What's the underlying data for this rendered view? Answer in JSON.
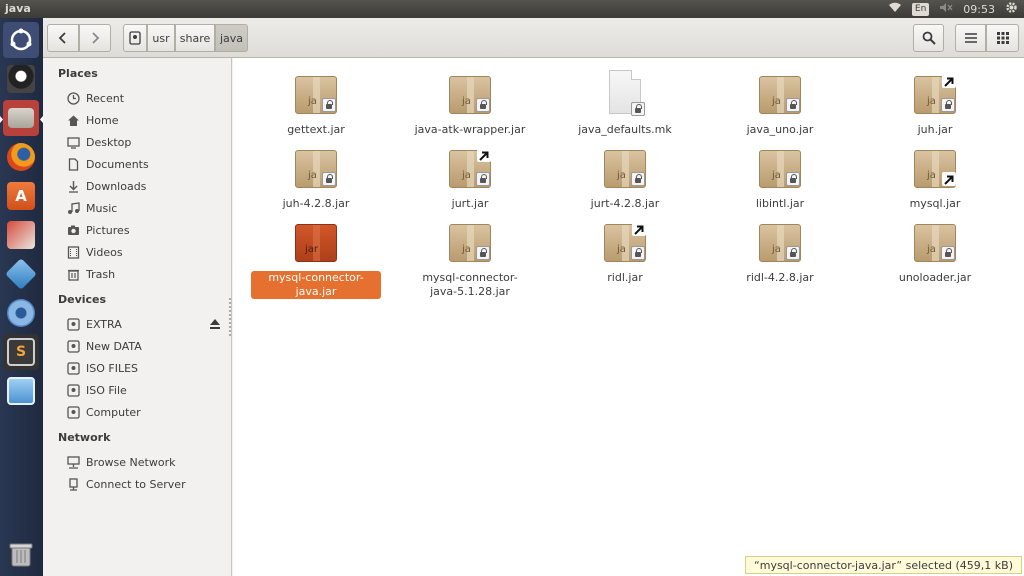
{
  "window_title": "java",
  "topbar": {
    "lang": "En",
    "clock": "09:53"
  },
  "launcher": {
    "apps": [
      "dash-icon",
      "inkscape-icon",
      "files-icon",
      "firefox-icon",
      "software-center-icon",
      "system-settings-icon",
      "virtualbox-icon",
      "tweak-icon",
      "sublime-text-icon",
      "image-viewer-icon",
      "trash-icon"
    ]
  },
  "toolbar": {
    "breadcrumbs": [
      "usr",
      "share",
      "java"
    ]
  },
  "sidebar": {
    "places_title": "Places",
    "places": [
      {
        "label": "Recent",
        "icon": "clock-icon"
      },
      {
        "label": "Home",
        "icon": "home-icon"
      },
      {
        "label": "Desktop",
        "icon": "desktop-icon"
      },
      {
        "label": "Documents",
        "icon": "document-icon"
      },
      {
        "label": "Downloads",
        "icon": "download-icon"
      },
      {
        "label": "Music",
        "icon": "music-icon"
      },
      {
        "label": "Pictures",
        "icon": "camera-icon"
      },
      {
        "label": "Videos",
        "icon": "film-icon"
      },
      {
        "label": "Trash",
        "icon": "trash-icon"
      }
    ],
    "devices_title": "Devices",
    "devices": [
      {
        "label": "EXTRA"
      },
      {
        "label": "New DATA"
      },
      {
        "label": "ISO FILES"
      },
      {
        "label": "ISO File"
      },
      {
        "label": "Computer"
      }
    ],
    "network_title": "Network",
    "network": [
      {
        "label": "Browse Network",
        "icon": "network-icon"
      },
      {
        "label": "Connect to Server",
        "icon": "server-icon"
      }
    ]
  },
  "files": [
    {
      "name": "gettext.jar",
      "type": "jar",
      "link": false
    },
    {
      "name": "java-atk-wrapper.jar",
      "type": "jar",
      "link": false
    },
    {
      "name": "java_defaults.mk",
      "type": "doc",
      "link": false
    },
    {
      "name": "java_uno.jar",
      "type": "jar",
      "link": false
    },
    {
      "name": "juh.jar",
      "type": "jar",
      "link": true
    },
    {
      "name": "juh-4.2.8.jar",
      "type": "jar",
      "link": false
    },
    {
      "name": "jurt.jar",
      "type": "jar",
      "link": true
    },
    {
      "name": "jurt-4.2.8.jar",
      "type": "jar",
      "link": false
    },
    {
      "name": "libintl.jar",
      "type": "jar",
      "link": false
    },
    {
      "name": "mysql.jar",
      "type": "jar",
      "link": true,
      "link_bottom": true
    },
    {
      "name": "mysql-connector-java.jar",
      "type": "jar",
      "link": false,
      "selected": true
    },
    {
      "name": "mysql-connector-java-5.1.28.jar",
      "type": "jar",
      "link": false
    },
    {
      "name": "ridl.jar",
      "type": "jar",
      "link": true
    },
    {
      "name": "ridl-4.2.8.jar",
      "type": "jar",
      "link": false
    },
    {
      "name": "unoloader.jar",
      "type": "jar",
      "link": false
    }
  ],
  "jar_label": "jar",
  "jar_label_locked": "ja",
  "status": "“mysql-connector-java.jar” selected  (459,1 kB)",
  "colors": {
    "accent": "#e5702f",
    "launcher": "#263250"
  }
}
